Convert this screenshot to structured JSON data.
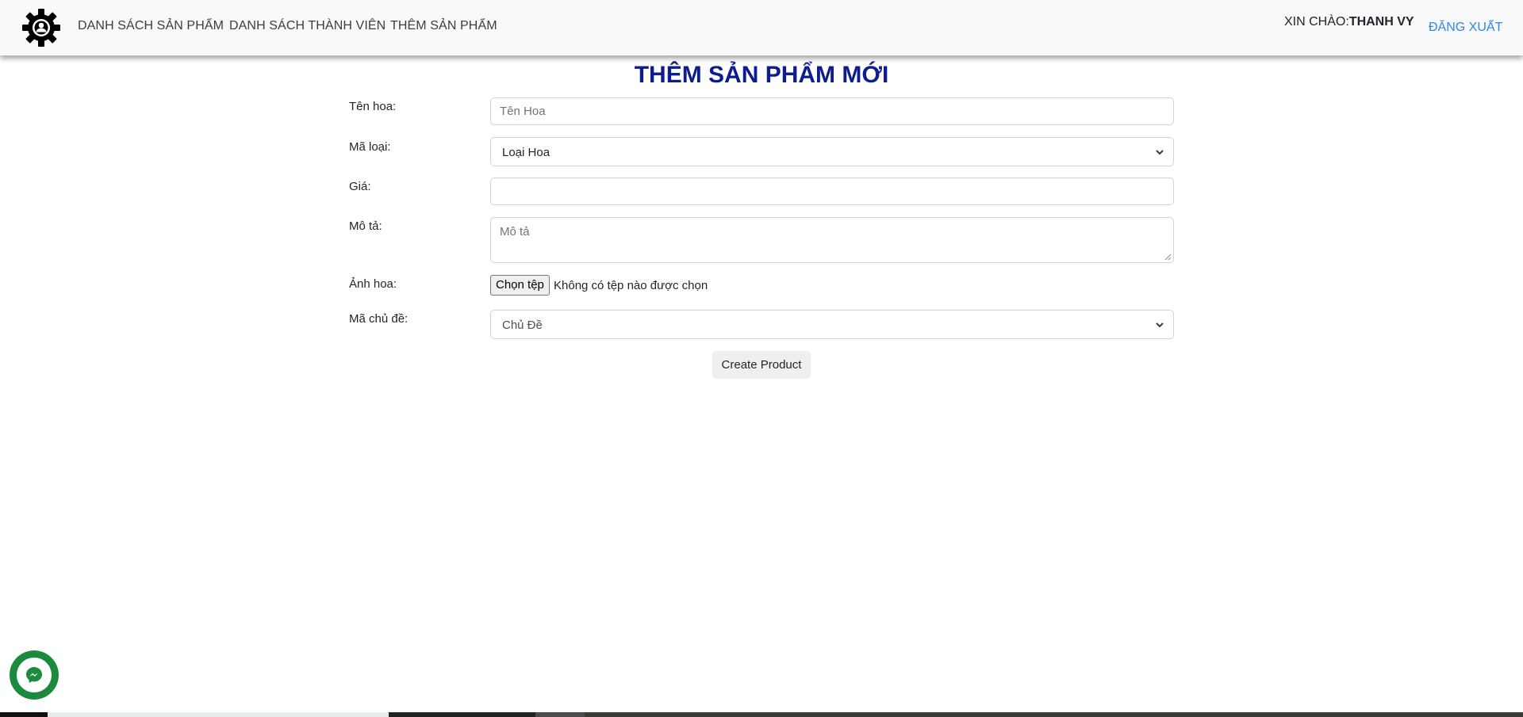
{
  "nav": {
    "links": [
      "DANH SÁCH SẢN PHẨM",
      "DANH SÁCH THÀNH VIÊN",
      "THÊM SẢN PHẨM"
    ],
    "greeting_prefix": "XIN CHÀO:",
    "user_name": "THANH VY",
    "logout_label": "ĐĂNG XUẤT",
    "logout_color": "#2f86e0",
    "logo_icon": "gear-user-icon"
  },
  "form": {
    "title": "THÊM SẢN PHẨM MỚI",
    "title_color": "#0d1d8f",
    "fields": {
      "name": {
        "label": "Tên hoa:",
        "placeholder": "Tên Hoa",
        "value": ""
      },
      "category": {
        "label": "Mã loại:",
        "selected": "Loại Hoa"
      },
      "price": {
        "label": "Giá:",
        "value": ""
      },
      "description": {
        "label": "Mô tả:",
        "placeholder": "Mô tả",
        "value": ""
      },
      "image": {
        "label": "Ảnh hoa:",
        "button_label": "Chọn tệp",
        "status": "Không có tệp nào được chọn"
      },
      "topic": {
        "label": "Mã chủ đề:",
        "selected": "Chủ Đề"
      }
    },
    "submit_label": "Create Product"
  },
  "messenger": {
    "icon": "messenger-icon",
    "color": "#1b8a3f"
  }
}
